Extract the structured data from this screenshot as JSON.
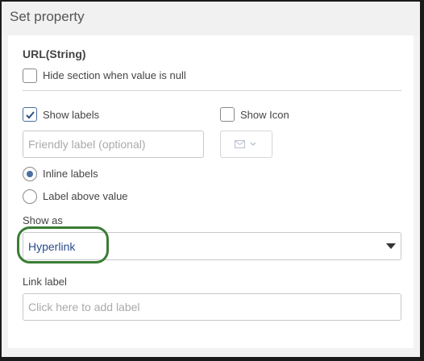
{
  "dialog": {
    "title": "Set property"
  },
  "section": {
    "title": "URL(String)"
  },
  "options": {
    "hide_section_label": "Hide section when value is null",
    "hide_section_checked": false,
    "show_labels_label": "Show labels",
    "show_labels_checked": true,
    "show_icon_label": "Show Icon",
    "show_icon_checked": false
  },
  "friendly_label": {
    "placeholder": "Friendly label (optional)",
    "value": ""
  },
  "icon_picker": {
    "icon": "envelope-icon"
  },
  "label_position": {
    "options": [
      "Inline labels",
      "Label above value"
    ],
    "selected": "Inline labels"
  },
  "show_as": {
    "label": "Show as",
    "value": "Hyperlink"
  },
  "link_label": {
    "label": "Link label",
    "placeholder": "Click here to add label",
    "value": ""
  },
  "colors": {
    "accent": "#4a6fa0",
    "highlight": "#3a7d34",
    "link": "#2b4c8c"
  }
}
